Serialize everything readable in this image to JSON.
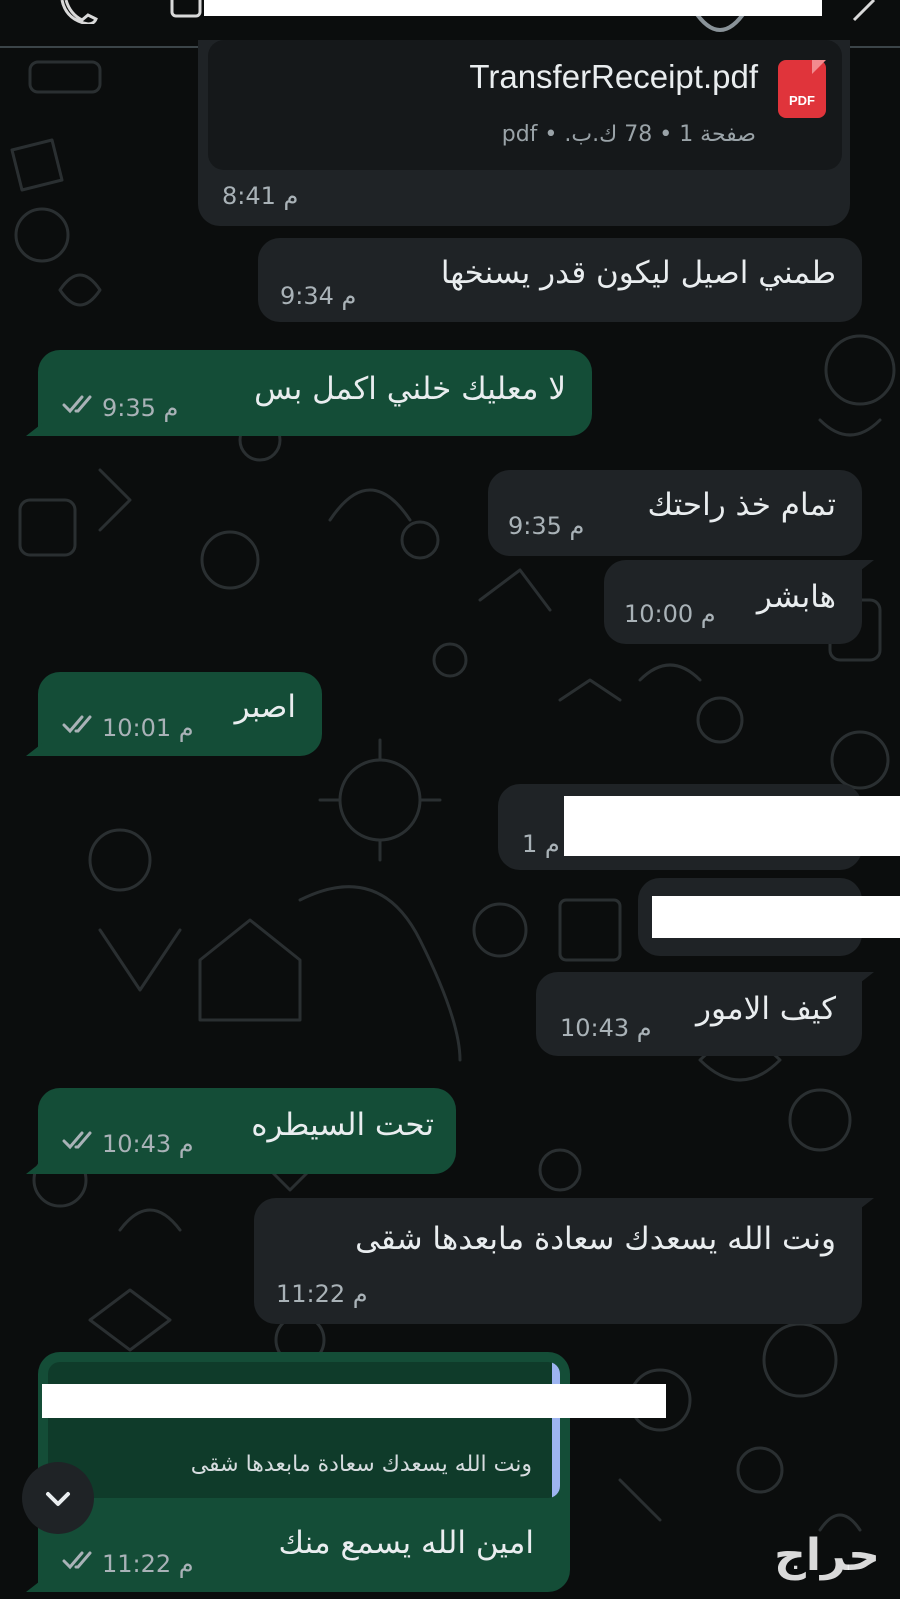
{
  "header": {},
  "messages": {
    "file": {
      "name": "TransferReceipt.pdf",
      "meta": "صفحة 1 • 78 ك.ب. • pdf",
      "icon_label": "PDF",
      "time": "8:41 م"
    },
    "m1": {
      "text": "طمني اصيل ليكون قدر يسنخها",
      "time": "9:34 م"
    },
    "m2": {
      "text": "لا معليك خلني اكمل بس",
      "time": "9:35 م"
    },
    "m3": {
      "text": "تمام خذ راحتك",
      "time": "9:35 م"
    },
    "m4": {
      "text": "هابشر",
      "time": "10:00 م"
    },
    "m5": {
      "text": "اصبر",
      "time": "10:01 م"
    },
    "m6": {
      "time_fragment": "1 م"
    },
    "m8": {
      "text": "كيف الامور",
      "time": "10:43 م"
    },
    "m9": {
      "text": "تحت السيطره",
      "time": "10:43 م"
    },
    "m10": {
      "text": "ونت الله يسعدك سعادة مابعدها شقى",
      "time": "11:22 م"
    },
    "m11": {
      "quoted_text": "ونت الله يسعدك سعادة مابعدها شقى",
      "text": "امين الله يسمع منك",
      "time": "11:22 م"
    }
  },
  "watermark": {
    "text": "حراج"
  },
  "colors": {
    "background": "#0b0d0d",
    "incoming_bubble": "#1f2326",
    "outgoing_bubble": "#144d37",
    "pdf_icon": "#e0343b",
    "quote_bar": "#9db4f0",
    "ticks": "#a9b2b7"
  },
  "icons": [
    "phone-icon",
    "video-icon",
    "more-icon",
    "pdf-icon",
    "double-check-icon",
    "chevron-down-icon"
  ]
}
